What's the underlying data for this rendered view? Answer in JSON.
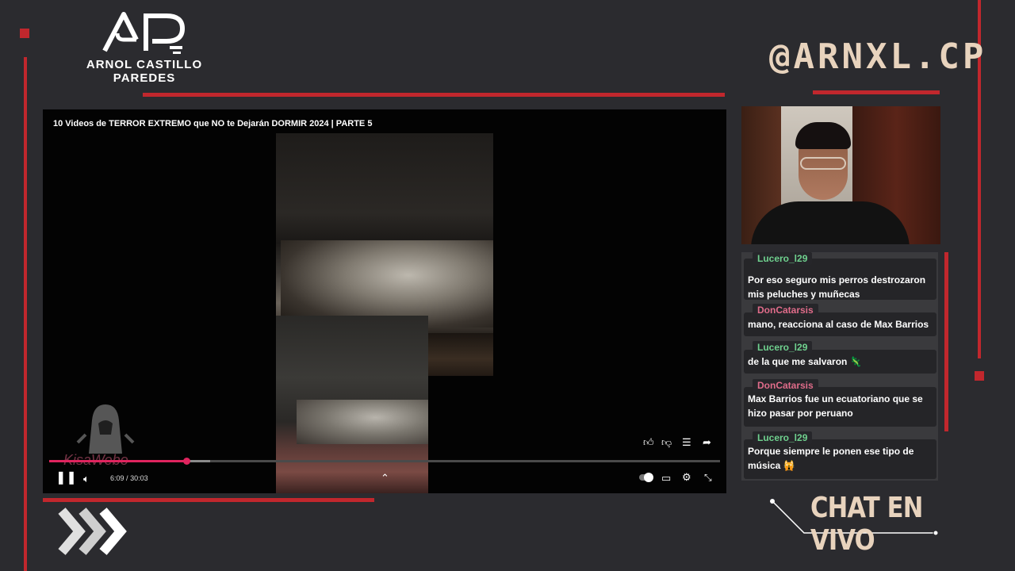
{
  "brand": {
    "line1": "ARNOL CASTILLO",
    "line2": "PAREDES",
    "handle": "@ARNXL.CP"
  },
  "player": {
    "video_title": "10 Videos de TERROR EXTREMO que NO te Dejarán DORMIR 2024 | PARTE 5",
    "time_current": "6:09",
    "time_separator": "/",
    "time_total": "30:03",
    "progress_fraction": 0.205,
    "watermark": "KisaWebo"
  },
  "chat": {
    "title": "CHAT EN VIVO",
    "messages": [
      {
        "user": "Lucero_l29",
        "text": "Por eso seguro mis perros destrozaron mis peluches y muñecas",
        "emoji": ""
      },
      {
        "user": "DonCatarsis",
        "text": "mano, reacciona al caso de Max Barrios",
        "emoji": ""
      },
      {
        "user": "Lucero_l29",
        "text": "de la que me salvaron",
        "emoji": "🦎"
      },
      {
        "user": "DonCatarsis",
        "text": "Max Barrios fue un ecuatoriano que se hizo pasar por peruano",
        "emoji": ""
      },
      {
        "user": "Lucero_l29",
        "text": "Porque siempre le ponen ese tipo de música",
        "emoji": "🙀"
      }
    ]
  },
  "colors": {
    "background": "#2b2b2f",
    "accent_red": "#c1272d",
    "handle_cream": "#e8d3bd",
    "chat_green": "#6fd18e",
    "chat_pink": "#e06c8a"
  }
}
